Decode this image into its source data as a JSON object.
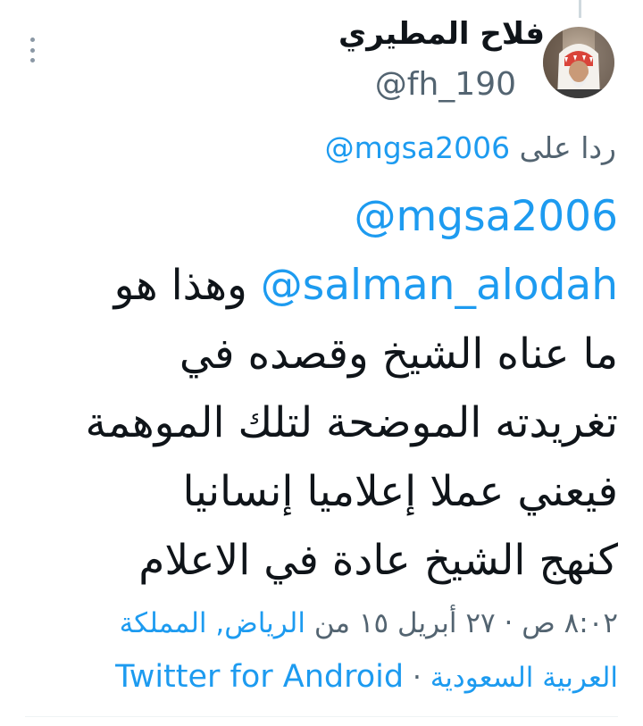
{
  "tweet": {
    "author": {
      "display_name": "فلاح المطيري",
      "handle": "@fh_190"
    },
    "reply_to": {
      "prefix": "ردا على",
      "mention": "@mgsa2006"
    },
    "body": {
      "mention_1": "@mgsa2006",
      "mention_2": "@salman_alodah",
      "line_2_text": " وهذا هو",
      "line_3": "ما  عناه الشيخ وقصده في",
      "line_4": "تغريدته الموضحة لتلك الموهمة",
      "line_5": "فيعني عملا إعلاميا إنسانيا",
      "line_6": "كنهج الشيخ عادة في الاعلام"
    },
    "meta": {
      "time": "٨:٠٢ ص",
      "separator": " · ",
      "date": "٢٧ أبريل ١٥",
      "location_prefix": " من ",
      "location_part_1": "الرياض, المملكة",
      "location_part_2": "العربية السعودية",
      "source": "Twitter for Android"
    }
  },
  "colors": {
    "link": "#1d9bf0",
    "secondary_text": "#536471",
    "primary_text": "#0f1419",
    "background": "#ffffff"
  },
  "icons": {
    "more": "more-vertical-icon",
    "avatar": "avatar"
  }
}
